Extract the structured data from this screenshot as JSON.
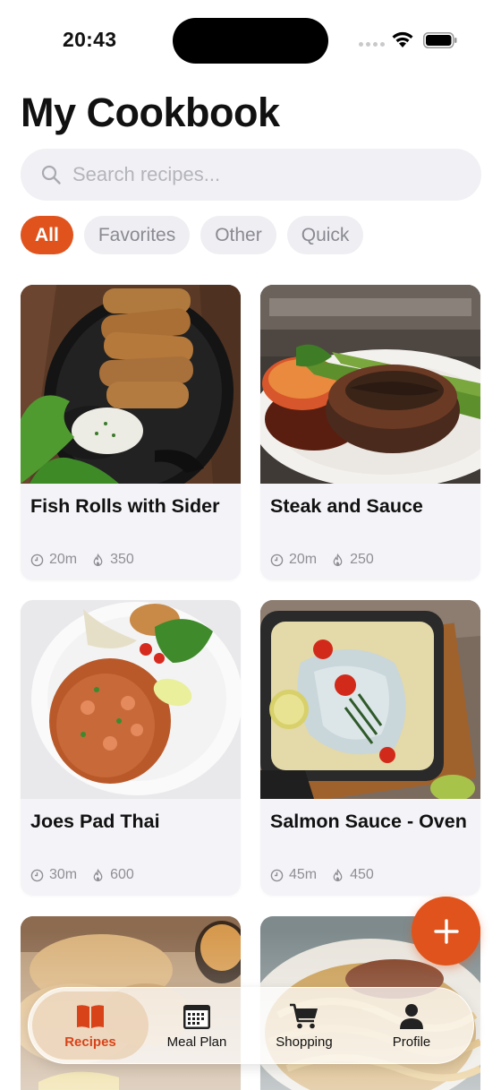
{
  "status_bar": {
    "time": "20:43"
  },
  "header": {
    "title": "My Cookbook"
  },
  "search": {
    "placeholder": "Search recipes..."
  },
  "filters": [
    {
      "label": "All",
      "active": true
    },
    {
      "label": "Favorites",
      "active": false
    },
    {
      "label": "Other",
      "active": false
    },
    {
      "label": "Quick",
      "active": false
    }
  ],
  "recipes": [
    {
      "title": "Fish Rolls with Sider",
      "time": "20m",
      "calories": "350"
    },
    {
      "title": "Steak and Sauce",
      "time": "20m",
      "calories": "250"
    },
    {
      "title": "Joes Pad Thai",
      "time": "30m",
      "calories": "600"
    },
    {
      "title": "Salmon Sauce - Oven",
      "time": "45m",
      "calories": "450"
    }
  ],
  "icons": {
    "search": "search-icon",
    "clock": "clock-icon",
    "calories": "flame-icon",
    "add": "plus-icon"
  },
  "tab_bar": [
    {
      "label": "Recipes",
      "icon": "book-icon",
      "active": true
    },
    {
      "label": "Meal Plan",
      "icon": "calendar-icon",
      "active": false
    },
    {
      "label": "Shopping",
      "icon": "cart-icon",
      "active": false
    },
    {
      "label": "Profile",
      "icon": "person-icon",
      "active": false
    }
  ],
  "colors": {
    "accent": "#e0531c",
    "chip_bg": "#eeeef3",
    "card_bg": "#f4f4f8",
    "muted_text": "#8e8e95"
  }
}
